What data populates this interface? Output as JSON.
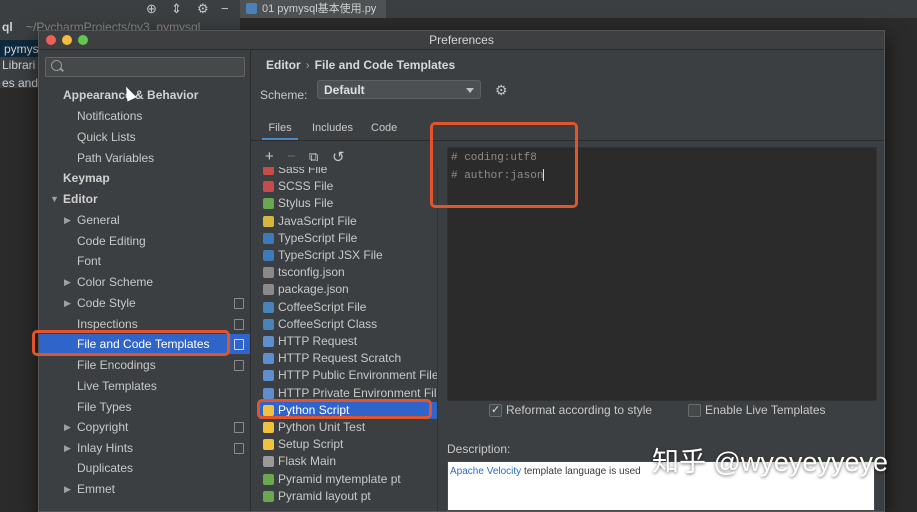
{
  "ide": {
    "tab_label": "01 pymysql基本使用.py",
    "tree_rows": [
      "ql",
      "~/PycharmProjects/py3_pymysql",
      "pymysql基",
      "Librari",
      "es and C"
    ]
  },
  "dialog": {
    "title": "Preferences"
  },
  "search": {
    "placeholder": ""
  },
  "sidebar": {
    "items": [
      {
        "label": "Appearance & Behavior"
      },
      {
        "label": "Notifications"
      },
      {
        "label": "Quick Lists"
      },
      {
        "label": "Path Variables"
      },
      {
        "label": "Keymap"
      },
      {
        "label": "Editor"
      },
      {
        "label": "General"
      },
      {
        "label": "Code Editing"
      },
      {
        "label": "Font"
      },
      {
        "label": "Color Scheme"
      },
      {
        "label": "Code Style"
      },
      {
        "label": "Inspections"
      },
      {
        "label": "File and Code Templates"
      },
      {
        "label": "File Encodings"
      },
      {
        "label": "Live Templates"
      },
      {
        "label": "File Types"
      },
      {
        "label": "Copyright"
      },
      {
        "label": "Inlay Hints"
      },
      {
        "label": "Duplicates"
      },
      {
        "label": "Emmet"
      }
    ]
  },
  "breadcrumb": {
    "parent": "Editor",
    "separator": "›",
    "current": "File and Code Templates"
  },
  "scheme": {
    "label": "Scheme:",
    "value": "Default"
  },
  "tabs": [
    "Files",
    "Includes",
    "Code"
  ],
  "toolbar": {
    "add": "+",
    "remove": "−",
    "copy": "⧉",
    "reset": "↺"
  },
  "files": [
    {
      "label": "Sass File",
      "color": "#c94a4a"
    },
    {
      "label": "SCSS File",
      "color": "#c94a4a"
    },
    {
      "label": "Stylus File",
      "color": "#6aa84f"
    },
    {
      "label": "JavaScript File",
      "color": "#d4b640"
    },
    {
      "label": "TypeScript File",
      "color": "#3d7ab8"
    },
    {
      "label": "TypeScript JSX File",
      "color": "#3d7ab8"
    },
    {
      "label": "tsconfig.json",
      "color": "#8a8a8a"
    },
    {
      "label": "package.json",
      "color": "#8a8a8a"
    },
    {
      "label": "CoffeeScript File",
      "color": "#4a83b8"
    },
    {
      "label": "CoffeeScript Class",
      "color": "#4a83b8"
    },
    {
      "label": "HTTP Request",
      "color": "#5d8fcf"
    },
    {
      "label": "HTTP Request Scratch",
      "color": "#5d8fcf"
    },
    {
      "label": "HTTP Public Environment File",
      "color": "#5d8fcf"
    },
    {
      "label": "HTTP Private Environment File",
      "color": "#5d8fcf"
    },
    {
      "label": "Python Script",
      "color": "#f0c040"
    },
    {
      "label": "Python Unit Test",
      "color": "#f0c040"
    },
    {
      "label": "Setup Script",
      "color": "#f0c040"
    },
    {
      "label": "Flask Main",
      "color": "#9a9a9a"
    },
    {
      "label": "Pyramid mytemplate pt",
      "color": "#6aa84f"
    },
    {
      "label": "Pyramid layout pt",
      "color": "#6aa84f"
    }
  ],
  "editor": {
    "lines": [
      "# coding:utf8",
      "# author:jason"
    ]
  },
  "options": {
    "reformat": "Reformat according to style",
    "live_templates": "Enable Live Templates"
  },
  "description": {
    "label": "Description:",
    "link": "Apache Velocity",
    "text": " template language is used"
  },
  "watermark": "知乎 @wyeyeyyeye",
  "colors": {
    "selection": "#2f65ca",
    "callout": "#e0552c",
    "link": "#2a6cc5"
  }
}
